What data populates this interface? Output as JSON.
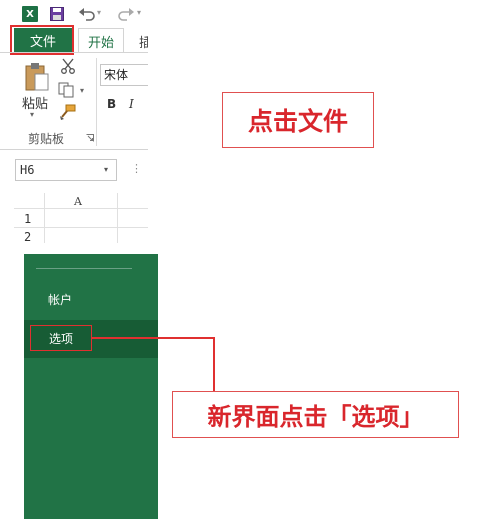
{
  "quick_access": {
    "app_icon": "excel-icon",
    "app_icon_letter": "X",
    "save_icon": "save-icon",
    "undo_icon": "undo-icon",
    "redo_icon": "redo-icon"
  },
  "tabs": {
    "file": "文件",
    "home": "开始",
    "next_partial": "插"
  },
  "ribbon": {
    "paste_label": "粘贴",
    "clipboard_group_label": "剪贴板",
    "font_name": "宋体",
    "bold_label": "B",
    "italic_label": "I"
  },
  "name_box": {
    "value": "H6"
  },
  "grid": {
    "columns": [
      "A"
    ],
    "rows": [
      "1",
      "2"
    ]
  },
  "backstage": {
    "account_label": "帐户",
    "options_label": "选项"
  },
  "annotations": {
    "click_file": "点击文件",
    "click_options": "新界面点击「选项」"
  },
  "colors": {
    "excel_green": "#217346",
    "annotation_red": "#d9262c"
  }
}
